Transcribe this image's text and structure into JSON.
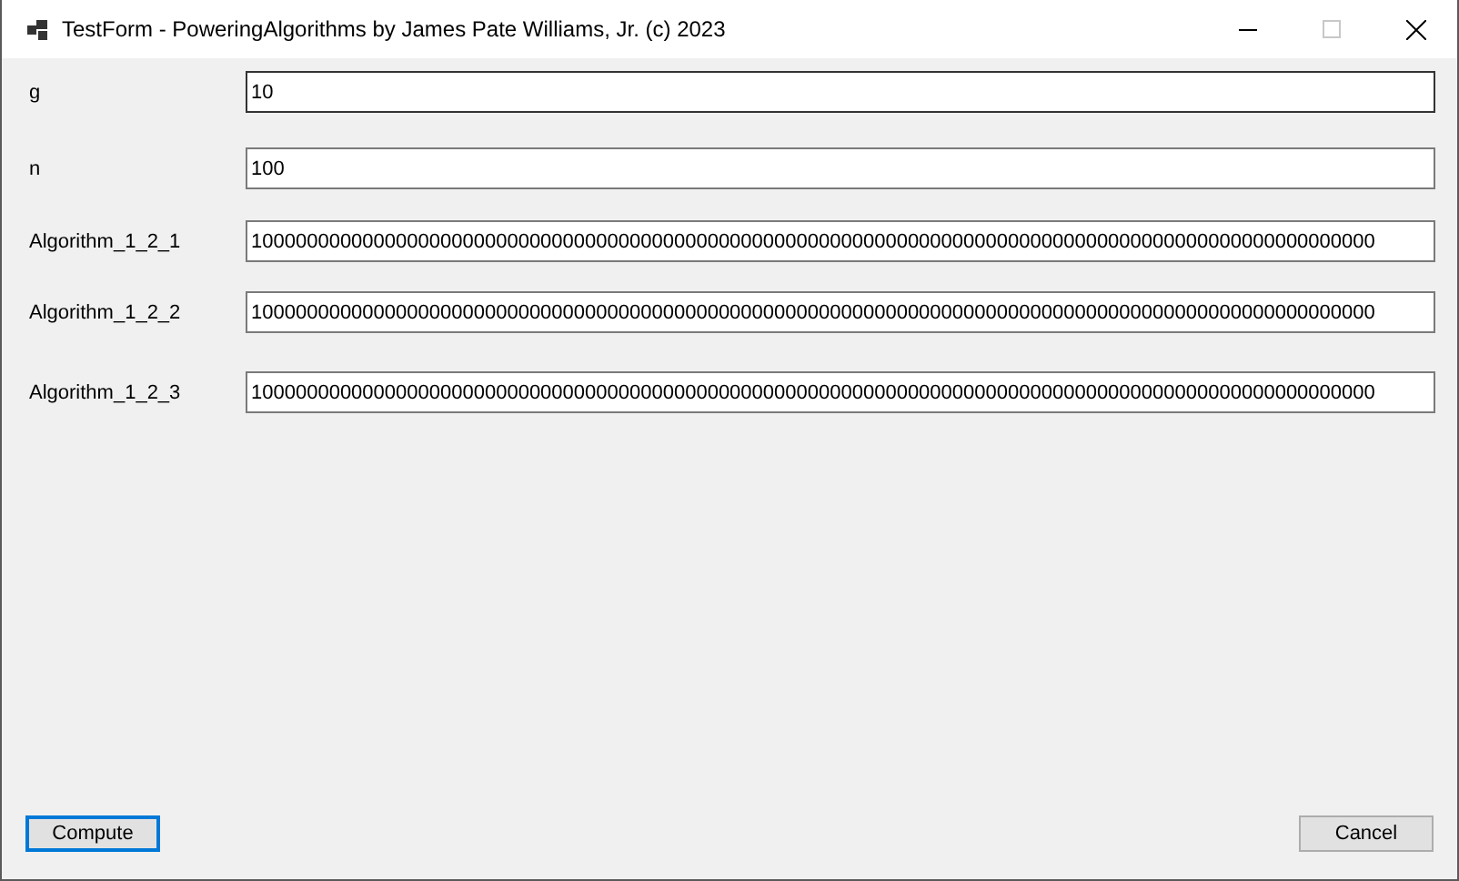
{
  "window": {
    "title": "TestForm - PoweringAlgorithms by James Pate Williams, Jr. (c) 2023",
    "maximize_disabled": true
  },
  "fields": [
    {
      "label": "g",
      "value": "10",
      "focused": true
    },
    {
      "label": "n",
      "value": "100",
      "focused": false
    },
    {
      "label": "Algorithm_1_2_1",
      "value": "10000000000000000000000000000000000000000000000000000000000000000000000000000000000000000000000000000",
      "focused": false
    },
    {
      "label": "Algorithm_1_2_2",
      "value": "10000000000000000000000000000000000000000000000000000000000000000000000000000000000000000000000000000",
      "focused": false
    },
    {
      "label": "Algorithm_1_2_3",
      "value": "10000000000000000000000000000000000000000000000000000000000000000000000000000000000000000000000000000",
      "focused": false
    }
  ],
  "buttons": [
    {
      "label": "Compute",
      "default": true
    },
    {
      "label": "Cancel",
      "default": false
    }
  ]
}
